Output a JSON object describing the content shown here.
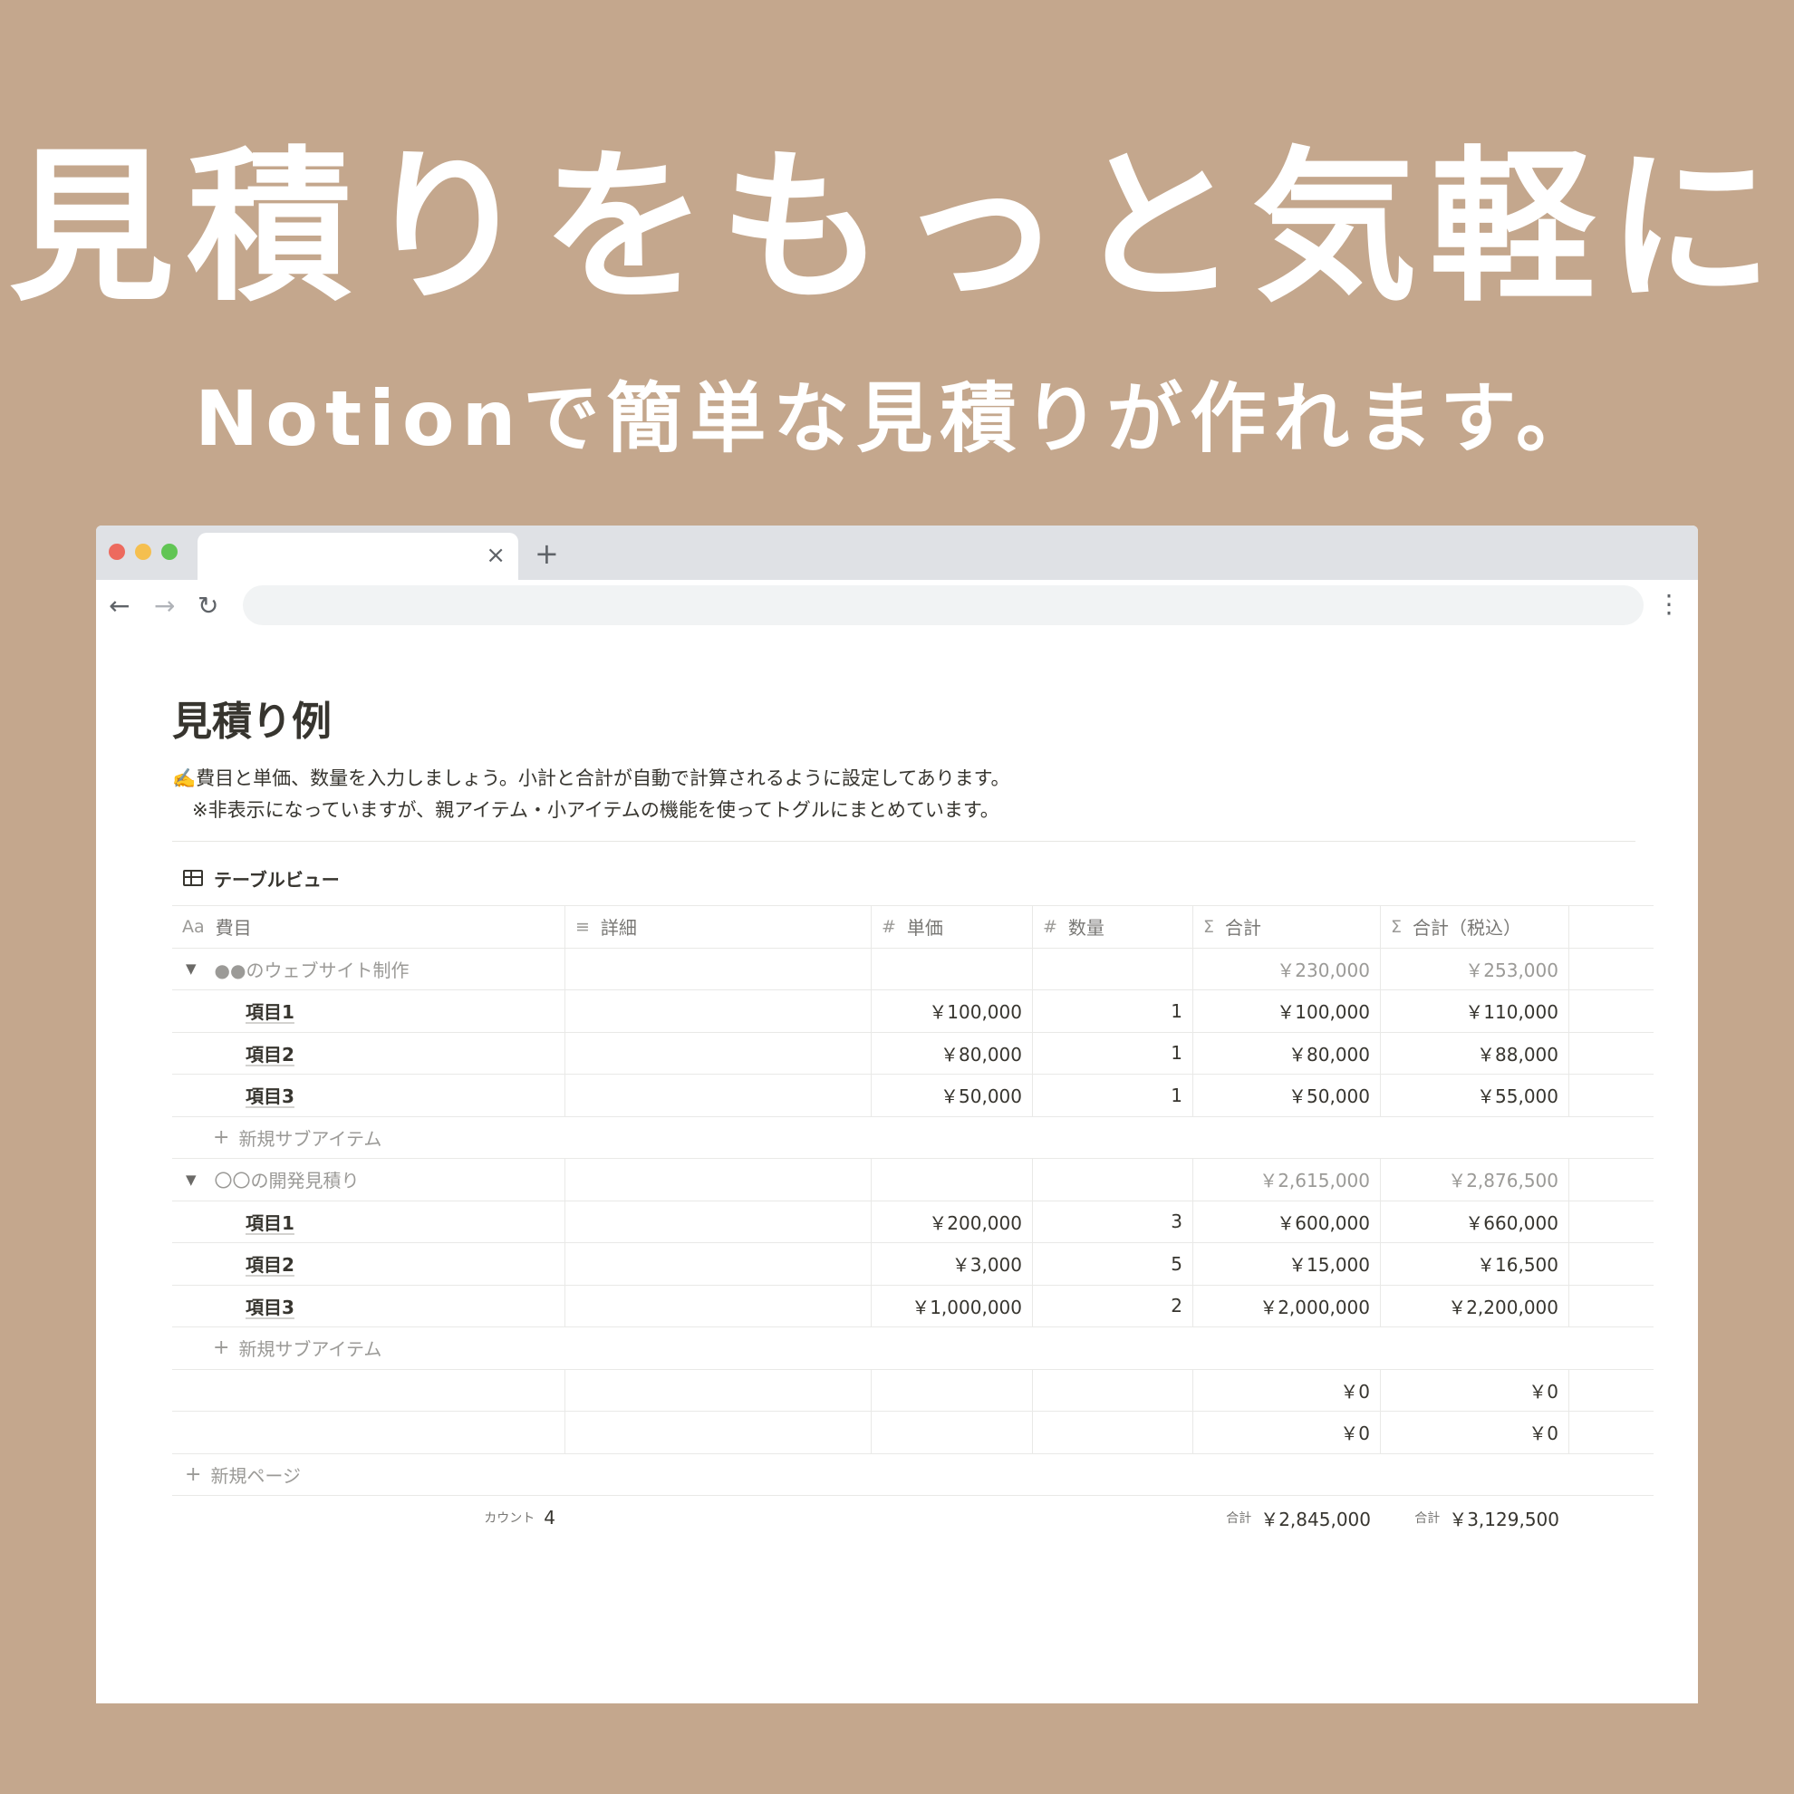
{
  "hero": {
    "title": "見積りをもっと気軽に",
    "subtitle": "Notionで簡単な見積りが作れます。"
  },
  "browser": {
    "close_icon": "×",
    "new_tab_icon": "+",
    "back_icon": "←",
    "forward_icon": "→",
    "reload_icon": "↻",
    "menu_icon": "⋮",
    "url": ""
  },
  "page": {
    "title": "見積り例",
    "desc_line1": "✍️費目と単価、数量を入力しましょう。小計と合計が自動で計算されるように設定してあります。",
    "desc_line2": "※非表示になっていますが、親アイテム・小アイテムの機能を使ってトグルにまとめています。"
  },
  "view": {
    "label": "テーブルビュー"
  },
  "columns": [
    {
      "icon": "Aa",
      "label": "費目"
    },
    {
      "icon": "≡",
      "label": "詳細"
    },
    {
      "icon": "#",
      "label": "単価"
    },
    {
      "icon": "#",
      "label": "数量"
    },
    {
      "icon": "Σ",
      "label": "合計"
    },
    {
      "icon": "Σ",
      "label": "合計（税込）"
    }
  ],
  "groups": [
    {
      "name": "●●のウェブサイト制作",
      "total": "￥230,000",
      "total_tax": "￥253,000",
      "items": [
        {
          "name": "項目1",
          "price": "￥100,000",
          "qty": "1",
          "total": "￥100,000",
          "total_tax": "￥110,000"
        },
        {
          "name": "項目2",
          "price": "￥80,000",
          "qty": "1",
          "total": "￥80,000",
          "total_tax": "￥88,000"
        },
        {
          "name": "項目3",
          "price": "￥50,000",
          "qty": "1",
          "total": "￥50,000",
          "total_tax": "￥55,000"
        }
      ],
      "add_sub_label": "新規サブアイテム"
    },
    {
      "name": "〇〇の開発見積り",
      "total": "￥2,615,000",
      "total_tax": "￥2,876,500",
      "items": [
        {
          "name": "項目1",
          "price": "￥200,000",
          "qty": "3",
          "total": "￥600,000",
          "total_tax": "￥660,000"
        },
        {
          "name": "項目2",
          "price": "￥3,000",
          "qty": "5",
          "total": "￥15,000",
          "total_tax": "￥16,500"
        },
        {
          "name": "項目3",
          "price": "￥1,000,000",
          "qty": "2",
          "total": "￥2,000,000",
          "total_tax": "￥2,200,000"
        }
      ],
      "add_sub_label": "新規サブアイテム"
    }
  ],
  "empty_rows": [
    {
      "total": "￥0",
      "total_tax": "￥0"
    },
    {
      "total": "￥0",
      "total_tax": "￥0"
    }
  ],
  "new_page_label": "新規ページ",
  "footer": {
    "count_label": "カウント",
    "count_value": "4",
    "sum_label": "合計",
    "sum_total": "￥2,845,000",
    "sum_label_tax": "合計",
    "sum_total_tax": "￥3,129,500"
  }
}
